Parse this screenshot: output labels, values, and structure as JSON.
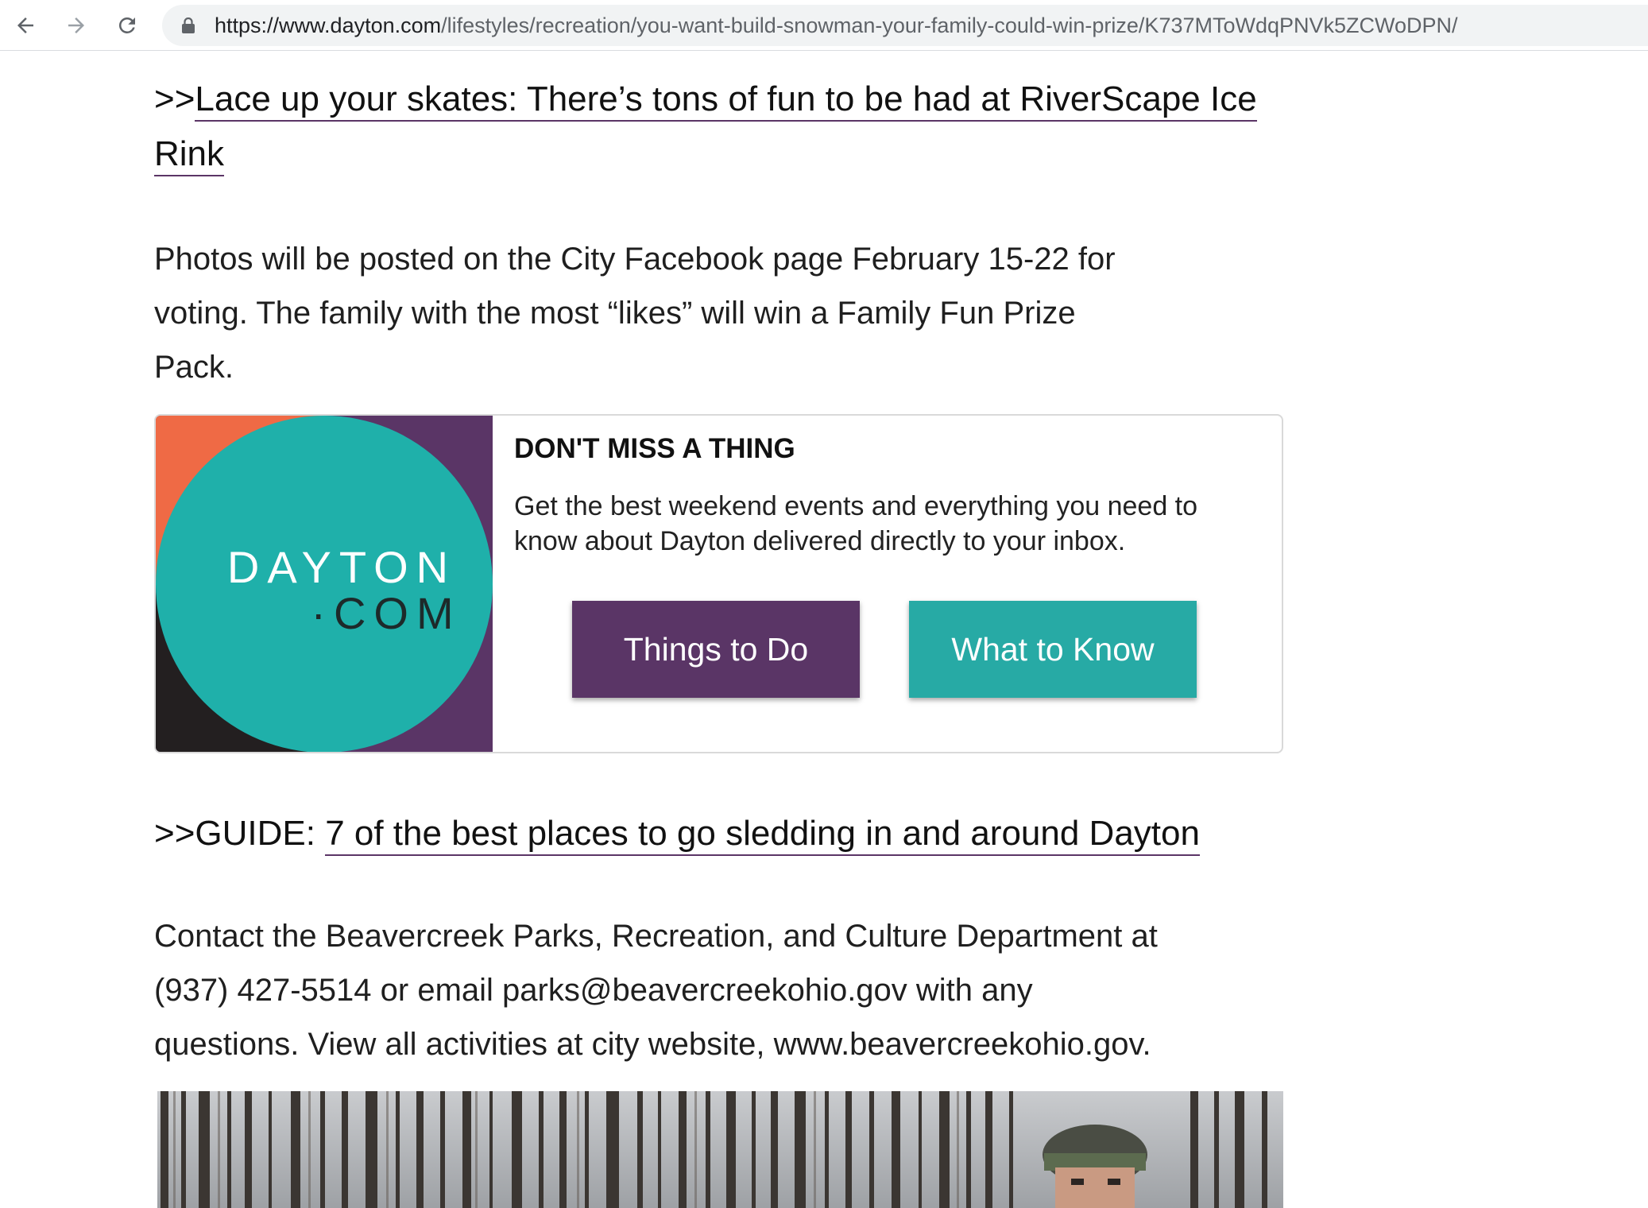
{
  "browser": {
    "url_host": "https://www.dayton.com",
    "url_path": "/lifestyles/recreation/you-want-build-snowman-your-family-could-win-prize/K737MToWdqPNVk5ZCWoDPN/",
    "back_icon": "arrow-left-icon",
    "forward_icon": "arrow-right-icon",
    "reload_icon": "reload-icon",
    "lock_icon": "lock-icon"
  },
  "article": {
    "link1_prefix": ">>",
    "link1_line1": "Lace up your skates: There’s tons of fun to be had at RiverScape Ice",
    "link1_line2": "Rink",
    "para1_line1": "Photos will be posted on the City Facebook page February 15-22 for",
    "para1_line2": "voting. The family with the most “likes” will win a Family Fun Prize",
    "para1_line3": "Pack.",
    "link2_prefix": ">>GUIDE: ",
    "link2_text": "7 of the best places to go sledding in and around Dayton",
    "para2_line1": "Contact the Beavercreek Parks, Recreation, and Culture Department at",
    "para2_line2": "(937) 427-5514 or email parks@beavercreekohio.gov with any",
    "para2_line3": "questions. View all activities at city website, www.beavercreekohio.gov."
  },
  "promo": {
    "logo_line1": "DAYTON",
    "logo_line2": "·COM",
    "title": "DON'T MISS A THING",
    "text_line1": "Get the best weekend events and everything you need to",
    "text_line2": "know about Dayton delivered directly to your inbox.",
    "button_things": "Things to Do",
    "button_know": "What to Know",
    "colors": {
      "purple": "#5a3566",
      "teal": "#27aaa5",
      "orange": "#ef6a45",
      "dark": "#231f20"
    }
  }
}
